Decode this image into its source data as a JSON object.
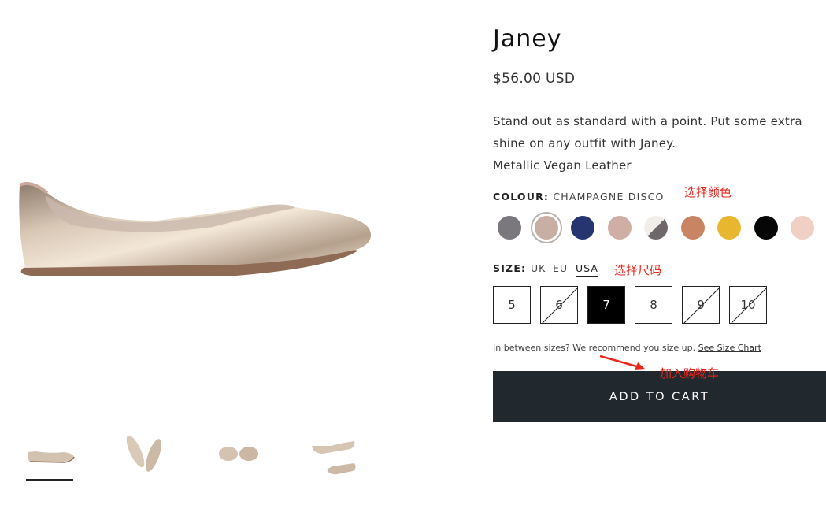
{
  "product": {
    "title": "Janey",
    "price": "$56.00 USD",
    "description": [
      "Stand out as standard with a point. Put some extra",
      "shine on any outfit with Janey.",
      "Metallic Vegan Leather"
    ]
  },
  "colour": {
    "label": "COLOUR:",
    "value": "CHAMPAGNE DISCO",
    "swatches": [
      {
        "name": "grey",
        "color": "#7b787d"
      },
      {
        "name": "champagne",
        "color": "#c9aea3",
        "selected": true
      },
      {
        "name": "navy",
        "color": "#26356f"
      },
      {
        "name": "blush",
        "color": "#cfaea5"
      },
      {
        "name": "white-grey-split",
        "colors": [
          "#f1ede8",
          "#6d676a"
        ]
      },
      {
        "name": "tan",
        "color": "#c98563"
      },
      {
        "name": "mustard",
        "color": "#e8b62f"
      },
      {
        "name": "black",
        "color": "#060606"
      },
      {
        "name": "light-pink",
        "color": "#f0cfc5"
      }
    ]
  },
  "size": {
    "label": "SIZE:",
    "units": [
      "UK",
      "EU",
      "USA"
    ],
    "active_unit": "USA",
    "options": [
      {
        "value": "5",
        "available": true
      },
      {
        "value": "6",
        "available": false
      },
      {
        "value": "7",
        "available": true,
        "selected": true
      },
      {
        "value": "8",
        "available": true
      },
      {
        "value": "9",
        "available": false
      },
      {
        "value": "10",
        "available": false
      }
    ],
    "note": "In between sizes? We recommend you size up.",
    "chart_link": "See Size Chart"
  },
  "cart": {
    "button_label": "ADD TO CART"
  },
  "annotations": {
    "colour": "选择颜色",
    "size": "选择尺码",
    "cart": "加入购物车"
  },
  "colors": {
    "button_bg": "#22292e",
    "annotation": "#e8261c"
  }
}
